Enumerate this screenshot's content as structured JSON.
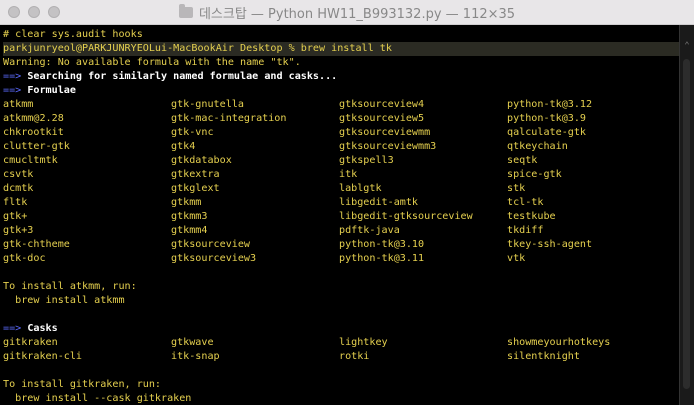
{
  "window": {
    "title": "데스크탑 — Python HW11_B993132.py — 112×35"
  },
  "terminal": {
    "comment_line": "# clear sys.audit hooks",
    "prompt_line": "parkjunryeol@PARKJUNRYEOLui-MacBookAir Desktop % brew install tk",
    "warning_line": "Warning: No available formula with the name \"tk\".",
    "search_arrow": "==>",
    "search_text": "Searching for similarly named formulae and casks...",
    "formulae_arrow": "==>",
    "formulae_header": "Formulae",
    "formulae": [
      [
        "atkmm",
        "gtk-gnutella",
        "gtksourceview4",
        "python-tk@3.12"
      ],
      [
        "atkmm@2.28",
        "gtk-mac-integration",
        "gtksourceview5",
        "python-tk@3.9"
      ],
      [
        "chkrootkit",
        "gtk-vnc",
        "gtksourceviewmm",
        "qalculate-gtk"
      ],
      [
        "clutter-gtk",
        "gtk4",
        "gtksourceviewmm3",
        "qtkeychain"
      ],
      [
        "cmucltmtk",
        "gtkdatabox",
        "gtkspell3",
        "seqtk"
      ],
      [
        "csvtk",
        "gtkextra",
        "itk",
        "spice-gtk"
      ],
      [
        "dcmtk",
        "gtkglext",
        "lablgtk",
        "stk"
      ],
      [
        "fltk",
        "gtkmm",
        "libgedit-amtk",
        "tcl-tk"
      ],
      [
        "gtk+",
        "gtkmm3",
        "libgedit-gtksourceview",
        "testkube"
      ],
      [
        "gtk+3",
        "gtkmm4",
        "pdftk-java",
        "tkdiff"
      ],
      [
        "gtk-chtheme",
        "gtksourceview",
        "python-tk@3.10",
        "tkey-ssh-agent"
      ],
      [
        "gtk-doc",
        "gtksourceview3",
        "python-tk@3.11",
        "vtk"
      ]
    ],
    "install_formula_hint": "To install atkmm, run:",
    "install_formula_cmd": "  brew install atkmm",
    "casks_arrow": "==>",
    "casks_header": "Casks",
    "casks": [
      [
        "gitkraken",
        "gtkwave",
        "lightkey",
        "showmeyourhotkeys"
      ],
      [
        "gitkraken-cli",
        "itk-snap",
        "rotki",
        "silentknight"
      ]
    ],
    "install_cask_hint": "To install gitkraken, run:",
    "install_cask_cmd": "  brew install --cask gitkraken"
  },
  "colors": {
    "text_yellow": "#e5d04f",
    "arrow_blue": "#5c6bff",
    "background": "#000000"
  },
  "icons": {
    "title_icon": "folder-icon",
    "scroll": "scroll-up-arrow-icon"
  }
}
